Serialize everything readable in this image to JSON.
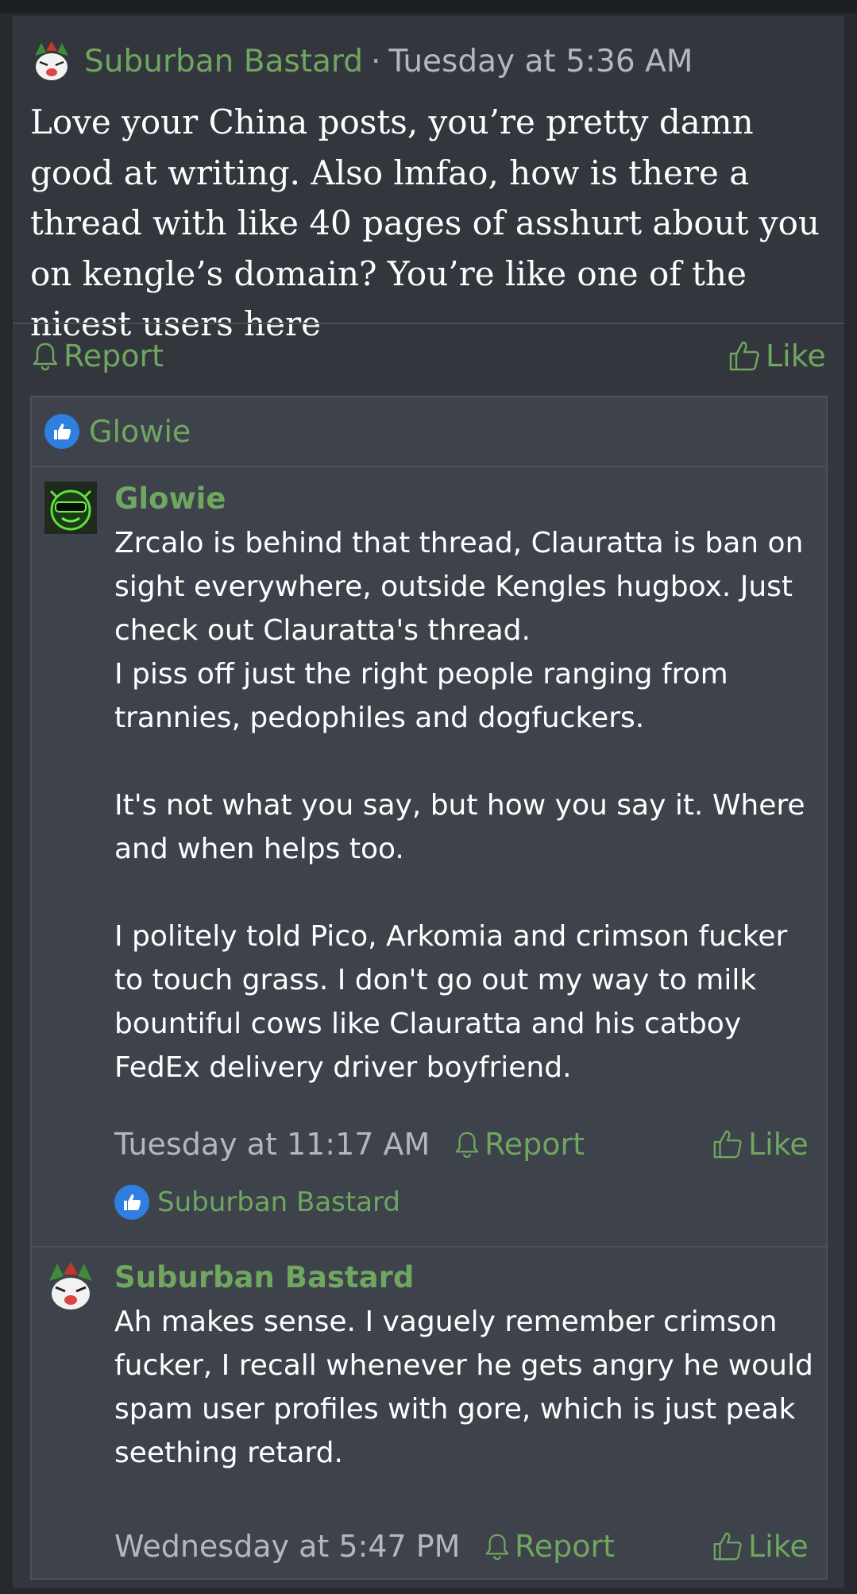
{
  "post": {
    "author": "Suburban Bastard",
    "separator": "·",
    "timestamp": "Tuesday at 5:36 AM",
    "body": "Love your China posts, you’re pretty damn good at writing. Also lmfao, how is there a thread with like 40 pages of asshurt about you on kengle’s domain? You’re like one of the nicest users here",
    "report_label": "Report",
    "like_label": "Like"
  },
  "likes": {
    "liker": "Glowie"
  },
  "replies": [
    {
      "author": "Glowie",
      "body": "Zrcalo is behind that thread, Clauratta is ban on sight everywhere, outside Kengles hugbox. Just check out Clauratta's thread.\nI piss off just the right people ranging from trannies, pedophiles and dogfuckers.\n\nIt's not what you say, but how you say it. Where and when helps too.\n\nI politely told Pico, Arkomia and crimson fucker to touch grass. I don't go out my way to milk bountiful cows like Clauratta and his catboy FedEx delivery driver boyfriend.",
      "timestamp": "Tuesday at 11:17 AM",
      "report_label": "Report",
      "like_label": "Like",
      "liked_by": "Suburban Bastard"
    },
    {
      "author": "Suburban Bastard",
      "body": "Ah makes sense. I vaguely remember crimson fucker, I recall whenever he gets angry he would spam user profiles with gore, which is just peak seething retard.",
      "timestamp": "Wednesday at 5:47 PM",
      "report_label": "Report",
      "like_label": "Like"
    }
  ],
  "colors": {
    "background": "#262a2f",
    "panel": "#33373d",
    "nested_panel": "#3e424a",
    "accent_green": "#6fa660",
    "muted_text": "#b4b7bc",
    "like_badge": "#2f7fe0"
  },
  "icons": {
    "report": "bell-icon",
    "like": "thumbs-up-icon",
    "like_badge": "like-badge-icon"
  }
}
